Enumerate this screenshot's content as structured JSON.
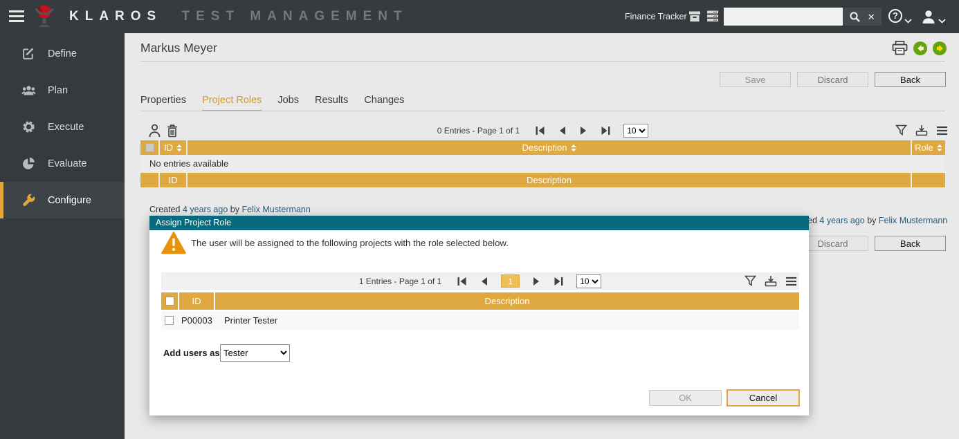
{
  "colors": {
    "accent_gold": "#dfa941",
    "topbar_bg": "#363b3e",
    "sidebar_bg": "#343a3d",
    "dialog_header_teal": "#086a7c",
    "nav_green": "#64a30d",
    "link_blue": "#2a5b77",
    "warning_orange": "#e8920c",
    "active_page_gold": "#eebd53"
  },
  "icons": {
    "hamburger-icon": "three bars",
    "klaros-logo": "red orb in gray chalice",
    "archive-icon": "archive box",
    "server-icon": "server stack",
    "search-icon": "magnifier",
    "clear-search-icon": "✕",
    "help-icon": "?",
    "user-icon": "person silhouette",
    "chevron-down-icon": "⌄",
    "define-icon": "pencil on square",
    "plan-icon": "people group",
    "execute-icon": "gear",
    "evaluate-icon": "pie chart",
    "configure-icon": "wrench",
    "print-icon": "printer",
    "back-icon": "left arrow in green circle",
    "forward-icon": "right arrow in green circle",
    "add-user-icon": "person outline",
    "delete-icon": "trash can",
    "filter-icon": "funnel",
    "export-icon": "tray with down arrow",
    "table-menu-icon": "three lines",
    "sort-icon": "up/down triangles",
    "warning-icon": "orange triangle with !"
  },
  "topbar": {
    "brand": "KLAROS",
    "brand_suffix": "TEST MANAGEMENT",
    "project_name": "Finance Tracker",
    "search": {
      "value": "",
      "placeholder": ""
    },
    "help_glyph": "?",
    "clear_glyph": "✕"
  },
  "sidebar": {
    "items": [
      {
        "label": "Define"
      },
      {
        "label": "Plan"
      },
      {
        "label": "Execute"
      },
      {
        "label": "Evaluate"
      },
      {
        "label": "Configure"
      }
    ],
    "active": "Configure"
  },
  "page": {
    "title": "Markus Meyer",
    "buttons": {
      "save": "Save",
      "discard": "Discard",
      "back": "Back"
    },
    "tabs": [
      {
        "label": "Properties"
      },
      {
        "label": "Project Roles"
      },
      {
        "label": "Jobs"
      },
      {
        "label": "Results"
      },
      {
        "label": "Changes"
      }
    ],
    "active_tab": "Project Roles"
  },
  "roles_table": {
    "entries_text": "0 Entries - Page 1 of 1",
    "page_size": "10",
    "header": {
      "id": "ID",
      "description": "Description",
      "role": "Role"
    },
    "empty_text": "No entries available",
    "meta": {
      "created_label": "Created",
      "created_time": "4 years ago",
      "by_label": "by",
      "author": "Felix Mustermann"
    }
  },
  "background_panel": {
    "meta_fragment": "ed",
    "meta_time": "4 years ago",
    "by_label": "by",
    "author": "Felix Mustermann",
    "discard": "Discard",
    "back": "Back"
  },
  "dialog": {
    "title": "Assign Project Role",
    "message": "The user will be assigned to the following projects with the role selected below.",
    "table": {
      "entries_text": "1 Entries - Page 1 of 1",
      "current_page": "1",
      "page_size": "10",
      "header": {
        "id": "ID",
        "description": "Description"
      },
      "rows": [
        {
          "id": "P00003",
          "description": "Printer Tester"
        }
      ]
    },
    "add_users_label": "Add users as",
    "role_value": "Tester",
    "ok": "OK",
    "cancel": "Cancel"
  }
}
